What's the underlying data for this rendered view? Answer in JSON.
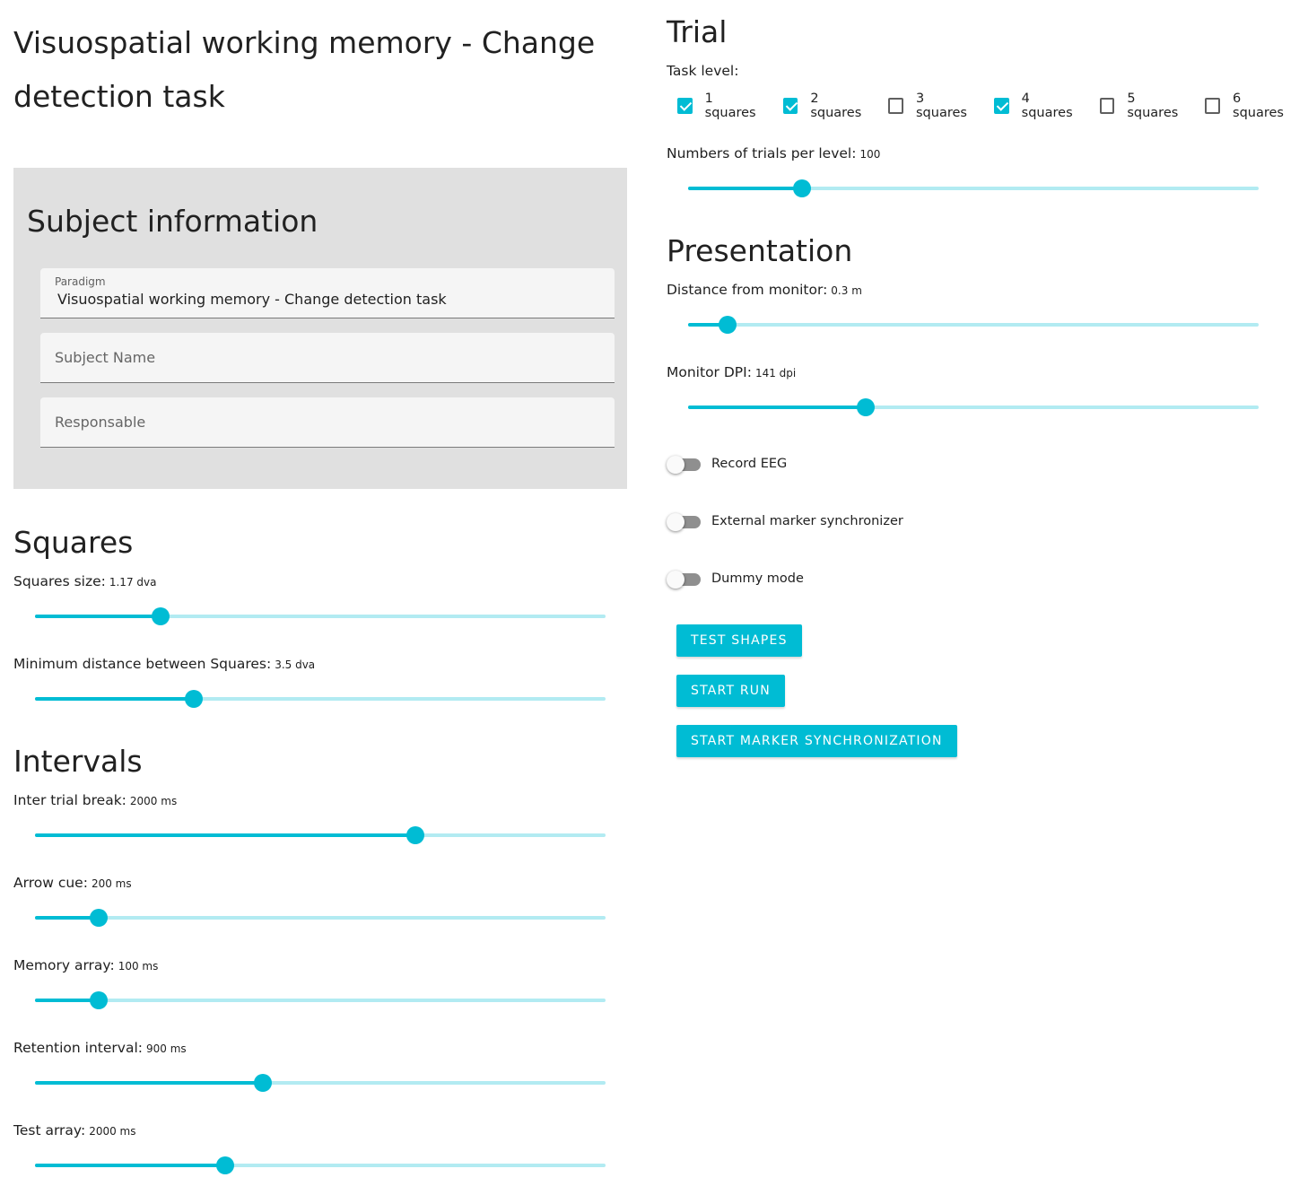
{
  "page_title": "Visuospatial working memory - Change detection task",
  "subject_info": {
    "heading": "Subject information",
    "paradigm_label": "Paradigm",
    "paradigm_value": "Visuospatial working memory - Change detection task",
    "subject_name_placeholder": "Subject Name",
    "responsable_placeholder": "Responsable"
  },
  "squares": {
    "heading": "Squares",
    "size": {
      "label": "Squares size:",
      "value": "1.17 dva",
      "fraction": 0.22
    },
    "min_distance": {
      "label": "Minimum distance between Squares:",
      "value": "3.5 dva",
      "fraction": 0.278
    }
  },
  "intervals": {
    "heading": "Intervals",
    "inter_trial": {
      "label": "Inter trial break:",
      "value": "2000 ms",
      "fraction": 0.667
    },
    "arrow_cue": {
      "label": "Arrow cue:",
      "value": "200 ms",
      "fraction": 0.111
    },
    "memory_array": {
      "label": "Memory array:",
      "value": "100 ms",
      "fraction": 0.111
    },
    "retention": {
      "label": "Retention interval:",
      "value": "900 ms",
      "fraction": 0.4
    },
    "test_array": {
      "label": "Test array:",
      "value": "2000 ms",
      "fraction": 0.333
    }
  },
  "trial": {
    "heading": "Trial",
    "task_level_label": "Task level:",
    "levels": [
      {
        "label": "1 squares",
        "checked": true
      },
      {
        "label": "2 squares",
        "checked": true
      },
      {
        "label": "3 squares",
        "checked": false
      },
      {
        "label": "4 squares",
        "checked": true
      },
      {
        "label": "5 squares",
        "checked": false
      },
      {
        "label": "6 squares",
        "checked": false
      }
    ],
    "trials_per_level": {
      "label": "Numbers of trials per level:",
      "value": "100",
      "fraction": 0.2
    }
  },
  "presentation": {
    "heading": "Presentation",
    "distance": {
      "label": "Distance from monitor:",
      "value": "0.3 m",
      "fraction": 0.069
    },
    "dpi": {
      "label": "Monitor DPI:",
      "value": "141 dpi",
      "fraction": 0.311
    }
  },
  "toggles": {
    "record_eeg": {
      "label": "Record EEG",
      "on": false
    },
    "external_marker": {
      "label": "External marker synchronizer",
      "on": false
    },
    "dummy_mode": {
      "label": "Dummy mode",
      "on": false
    }
  },
  "buttons": {
    "test_shapes": "TEST SHAPES",
    "start_run": "START RUN",
    "start_marker_sync": "START MARKER SYNCHRONIZATION"
  },
  "colors": {
    "accent": "#00bcd4",
    "accent_light": "#b2ebf2",
    "card_bg": "#e0e0e0"
  }
}
